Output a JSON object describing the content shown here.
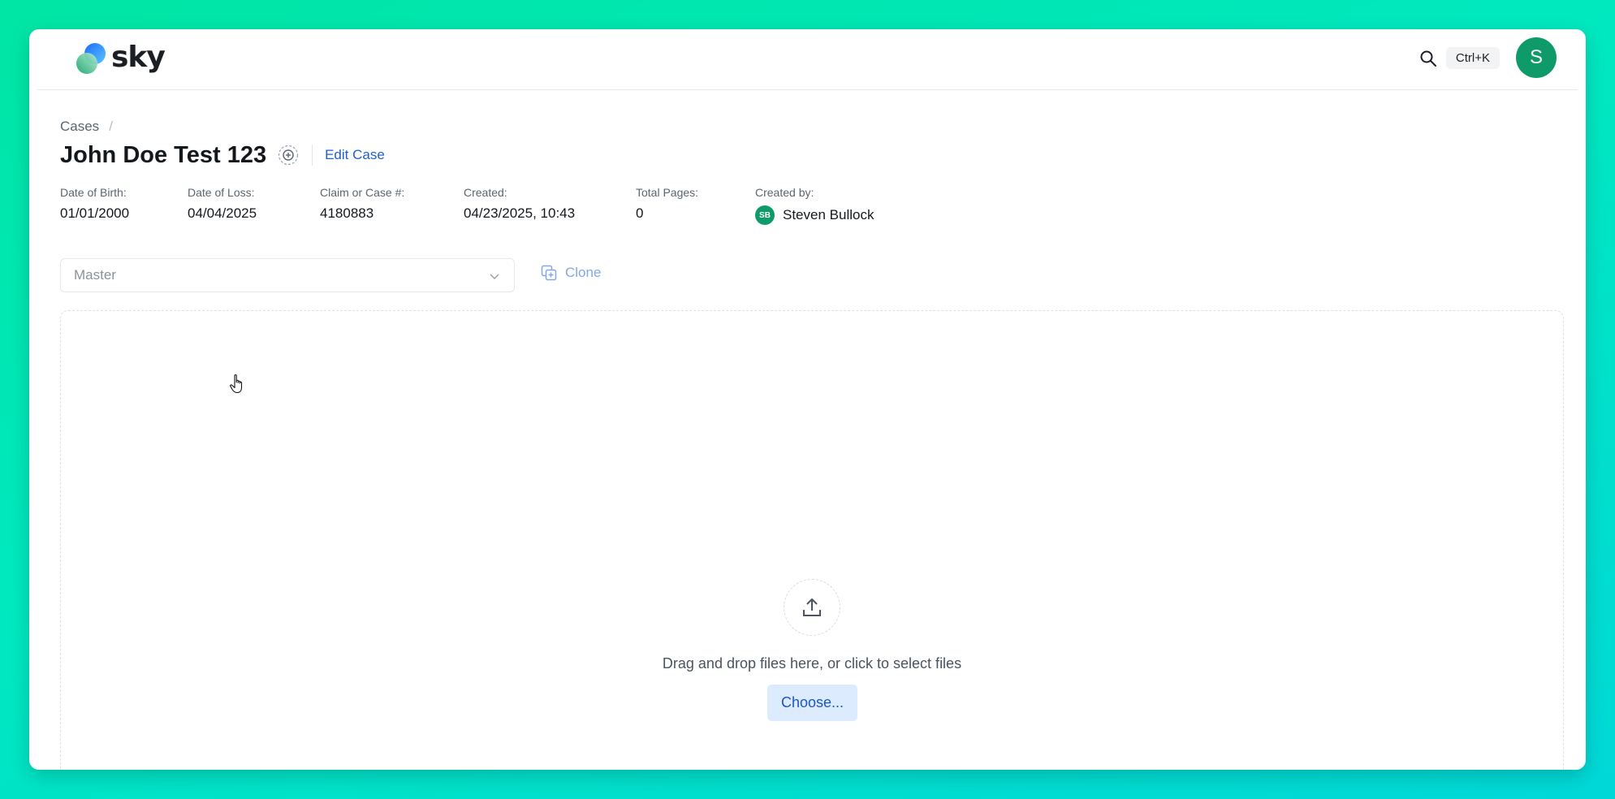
{
  "app": {
    "name": "sky"
  },
  "header": {
    "shortcut": "Ctrl+K",
    "avatar_initial": "S"
  },
  "breadcrumb": {
    "root": "Cases",
    "separator": "/"
  },
  "case": {
    "title": "John Doe Test 123",
    "edit_label": "Edit Case"
  },
  "meta": [
    {
      "label": "Date of Birth:",
      "value": "01/01/2000"
    },
    {
      "label": "Date of Loss:",
      "value": "04/04/2025"
    },
    {
      "label": "Claim or Case #:",
      "value": "4180883"
    },
    {
      "label": "Created:",
      "value": "04/23/2025, 10:43"
    },
    {
      "label": "Total Pages:",
      "value": "0"
    },
    {
      "label": "Created by:",
      "value": "Steven Bullock",
      "badge": "SB"
    }
  ],
  "version_select": {
    "selected": "Master"
  },
  "clone": {
    "label": "Clone"
  },
  "dropzone": {
    "text": "Drag and drop files here, or click to select files",
    "button_label": "Choose..."
  },
  "colors": {
    "accent": "#1f5fd1",
    "avatar": "#0e9a69",
    "choose_bg": "#dcebfd"
  }
}
